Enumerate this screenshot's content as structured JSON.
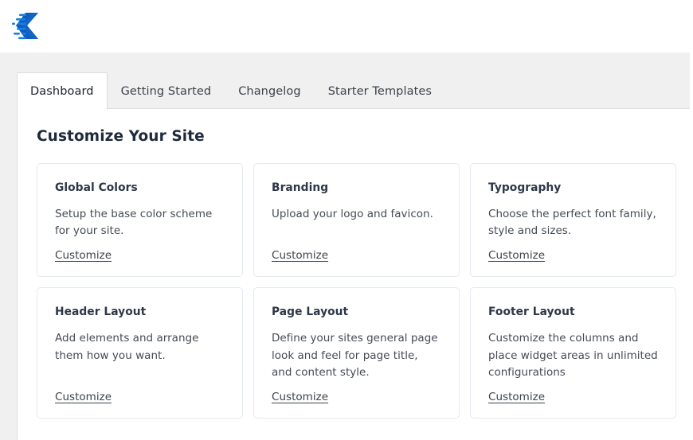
{
  "header": {
    "logo_name": "theme-logo",
    "logo_colors": {
      "primary": "#0b5cbf",
      "secondary": "#1b7fe0"
    }
  },
  "tabs": [
    {
      "label": "Dashboard",
      "active": true
    },
    {
      "label": "Getting Started",
      "active": false
    },
    {
      "label": "Changelog",
      "active": false
    },
    {
      "label": "Starter Templates",
      "active": false
    }
  ],
  "main": {
    "section_title": "Customize Your Site",
    "cards": [
      {
        "title": "Global Colors",
        "description": "Setup the base color scheme for your site.",
        "link_label": "Customize"
      },
      {
        "title": "Branding",
        "description": "Upload your logo and favicon.",
        "link_label": "Customize"
      },
      {
        "title": "Typography",
        "description": "Choose the perfect font family, style and sizes.",
        "link_label": "Customize"
      },
      {
        "title": "Header Layout",
        "description": "Add elements and arrange them how you want.",
        "link_label": "Customize"
      },
      {
        "title": "Page Layout",
        "description": "Define your sites general page look and feel for page title, and content style.",
        "link_label": "Customize"
      },
      {
        "title": "Footer Layout",
        "description": "Customize the columns and place widget areas in unlimited configurations",
        "link_label": "Customize"
      }
    ]
  },
  "colors": {
    "band_grey": "#f0f0f0",
    "panel_border": "#dcdcde",
    "card_border": "#e4e9f0",
    "title_text": "#1e293b",
    "body_text": "#444b55"
  }
}
